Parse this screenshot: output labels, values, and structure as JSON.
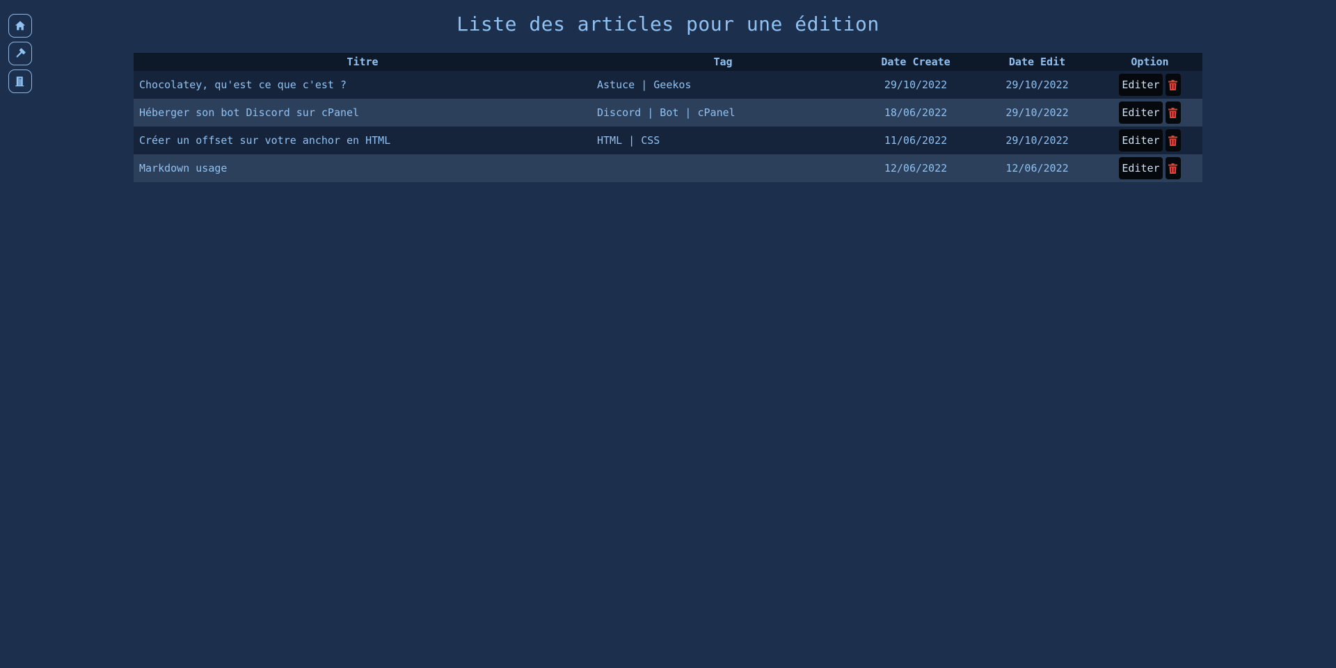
{
  "nav": {
    "items": [
      {
        "icon": "home-icon"
      },
      {
        "icon": "hammer-icon"
      },
      {
        "icon": "logout-door-icon"
      }
    ]
  },
  "page": {
    "title": "Liste des articles pour une édition"
  },
  "table": {
    "headers": {
      "title": "Titre",
      "tag": "Tag",
      "date_create": "Date Create",
      "date_edit": "Date Edit",
      "option": "Option"
    },
    "rows": [
      {
        "title": "Chocolatey, qu'est ce que c'est ?",
        "tag": "Astuce | Geekos",
        "date_create": "29/10/2022",
        "date_edit": "29/10/2022",
        "edit_label": "Editer"
      },
      {
        "title": "Héberger son bot Discord sur cPanel",
        "tag": "Discord | Bot | cPanel",
        "date_create": "18/06/2022",
        "date_edit": "29/10/2022",
        "edit_label": "Editer"
      },
      {
        "title": "Créer un offset sur votre anchor en HTML",
        "tag": "HTML | CSS",
        "date_create": "11/06/2022",
        "date_edit": "29/10/2022",
        "edit_label": "Editer"
      },
      {
        "title": "Markdown usage",
        "tag": "",
        "date_create": "12/06/2022",
        "date_edit": "12/06/2022",
        "edit_label": "Editer"
      }
    ]
  },
  "colors": {
    "background": "#1c2f4d",
    "text": "#8fc2f2",
    "header_row": "#0d1829",
    "row_odd": "#15243b",
    "row_even": "#2c3f5b",
    "button_bg": "#05080d",
    "delete_icon": "#e8413d"
  }
}
